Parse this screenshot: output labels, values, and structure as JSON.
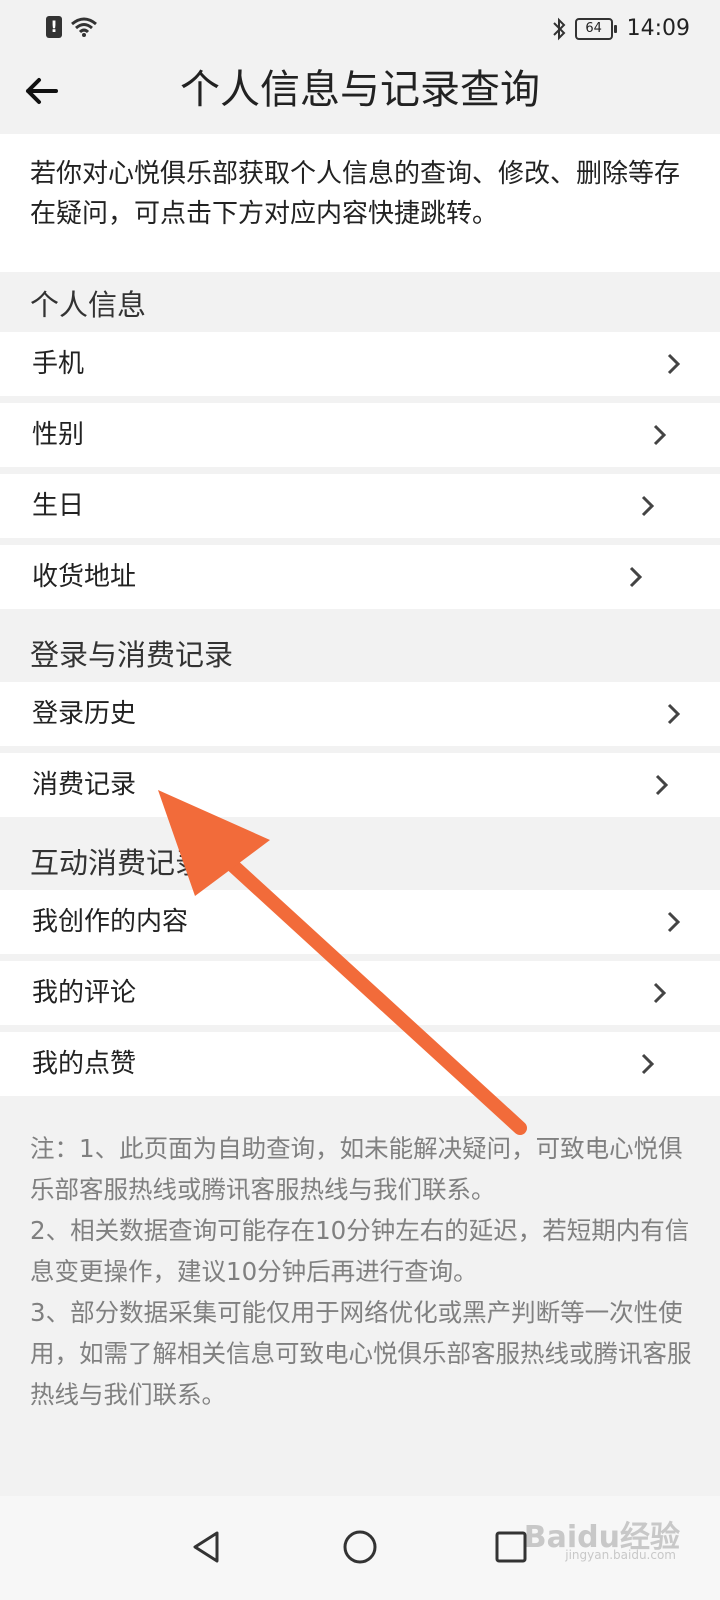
{
  "status_bar": {
    "time": "14:09",
    "battery": "64",
    "icons": [
      "alert-icon",
      "wifi-icon",
      "bluetooth-icon",
      "battery-icon"
    ]
  },
  "header": {
    "title": "个人信息与记录查询",
    "back_icon": "back-arrow-icon"
  },
  "intro": {
    "text": "若你对心悦俱乐部获取个人信息的查询、修改、删除等存在疑问，可点击下方对应内容快捷跳转。"
  },
  "sections": {
    "personal": {
      "title": "个人信息",
      "items": [
        "手机",
        "性别",
        "生日",
        "收货地址"
      ]
    },
    "login": {
      "title": "登录与消费记录",
      "items": [
        "登录历史",
        "消费记录"
      ]
    },
    "interaction": {
      "title": "互动消费记录",
      "items": [
        "我创作的内容",
        "我的评论",
        "我的点赞"
      ]
    }
  },
  "notes": {
    "line1": "注：1、此页面为自助查询，如未能解决疑问，可致电心悦俱乐部客服热线或腾讯客服热线与我们联系。",
    "line2": "2、相关数据查询可能存在10分钟左右的延迟，若短期内有信息变更操作，建议10分钟后再进行查询。",
    "line3": "3、部分数据采集可能仅用于网络优化或黑产判断等一次性使用，如需了解相关信息可致电心悦俱乐部客服热线或腾讯客服热线与我们联系。"
  },
  "nav_bar": {
    "icons": [
      "back-triangle-icon",
      "home-circle-icon",
      "recents-square-icon"
    ]
  },
  "watermark": {
    "text": "Baidu经验",
    "sub": "jingyan.baidu.com"
  },
  "colors": {
    "annotation_arrow": "#f26b3a",
    "background": "#f2f2f2",
    "row_background": "#ffffff"
  }
}
